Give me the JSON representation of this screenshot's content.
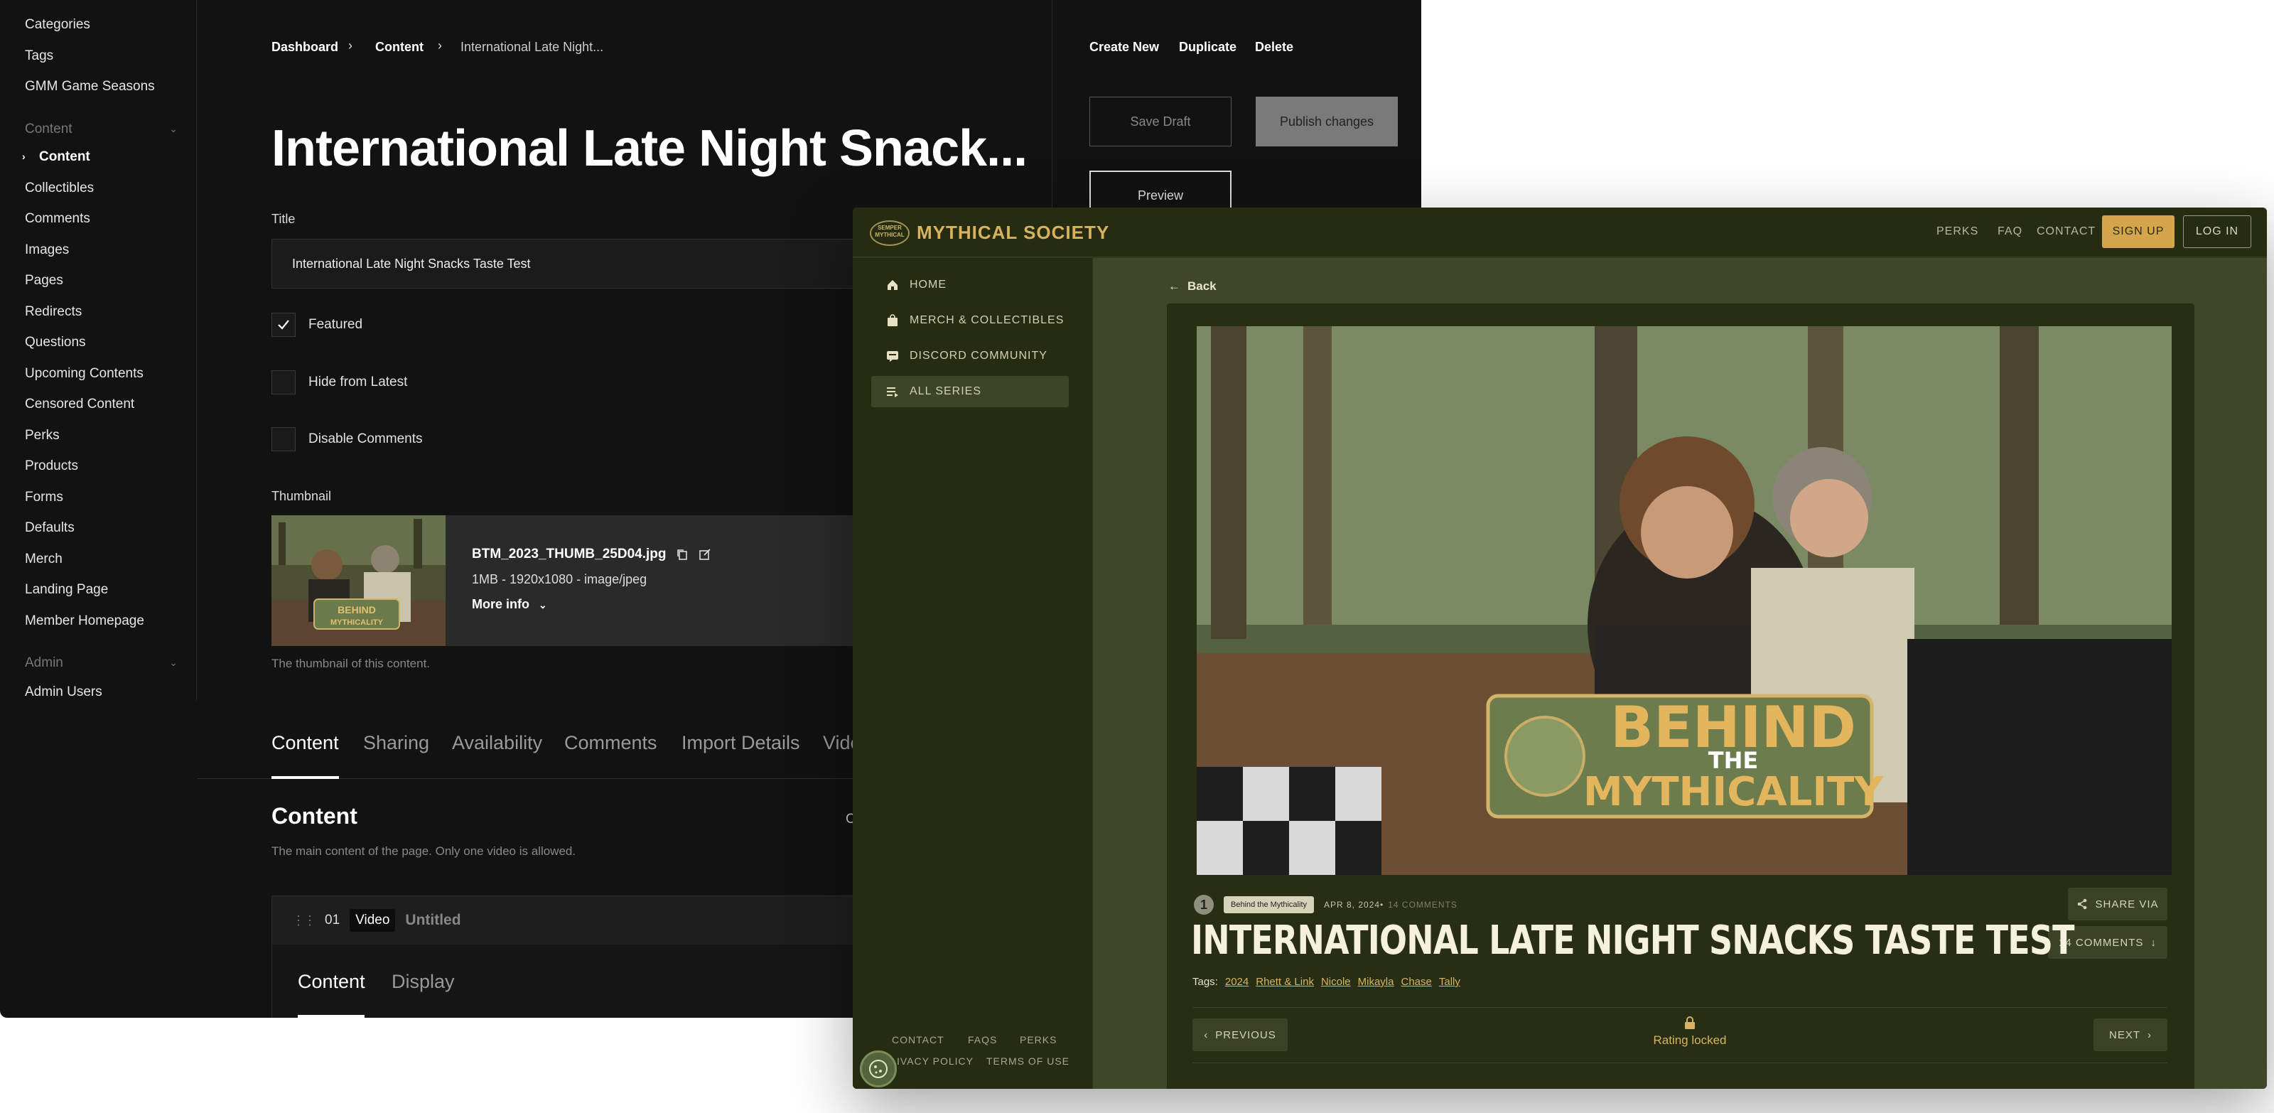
{
  "cms": {
    "sidebar": {
      "items_top": [
        "Categories",
        "Tags",
        "GMM Game Seasons"
      ],
      "content_group": "Content",
      "content_items": [
        "Content",
        "Collectibles",
        "Comments",
        "Images",
        "Pages",
        "Redirects",
        "Questions",
        "Upcoming Contents",
        "Censored Content",
        "Perks",
        "Products",
        "Forms",
        "Defaults",
        "Merch",
        "Landing Page",
        "Member Homepage"
      ],
      "admin_group": "Admin",
      "admin_items": [
        "Admin Users"
      ]
    },
    "breadcrumb": {
      "dashboard": "Dashboard",
      "content": "Content",
      "current": "International Late Night..."
    },
    "page_title": "International Late Night Snack...",
    "title_label": "Title",
    "title_value": "International Late Night Snacks Taste Test",
    "checkboxes": {
      "featured": "Featured",
      "hide_latest": "Hide from Latest",
      "disable_comments": "Disable Comments"
    },
    "thumbnail": {
      "label": "Thumbnail",
      "filename": "BTM_2023_THUMB_25D04.jpg",
      "meta": "1MB - 1920x1080 - image/jpeg",
      "more_info": "More info",
      "help": "The thumbnail of this content."
    },
    "tabs": [
      "Content",
      "Sharing",
      "Availability",
      "Comments",
      "Import Details",
      "Vide"
    ],
    "section": {
      "title": "Content",
      "help": "The main content of the page. Only one video is allowed.",
      "truncated": "C"
    },
    "block": {
      "number": "01",
      "type": "Video",
      "name": "Untitled",
      "tabs": [
        "Content",
        "Display"
      ]
    },
    "actions": {
      "create_new": "Create New",
      "duplicate": "Duplicate",
      "delete": "Delete",
      "save_draft": "Save Draft",
      "publish": "Publish changes",
      "preview": "Preview"
    }
  },
  "site": {
    "logo_badge": "SEMPER MYTHICAL",
    "logo_text": "MYTHICAL SOCIETY",
    "nav": [
      "PERKS",
      "FAQ",
      "CONTACT"
    ],
    "signup": "SIGN UP",
    "login": "LOG IN",
    "sidebar": [
      "HOME",
      "MERCH & COLLECTIBLES",
      "DISCORD COMMUNITY",
      "ALL SERIES"
    ],
    "footer": {
      "contact": "CONTACT",
      "faqs": "FAQS",
      "perks": "PERKS",
      "privacy": "IVACY POLICY",
      "terms": "TERMS OF USE"
    },
    "back": "Back",
    "video_overlay": {
      "line1": "BEHIND",
      "line2": "THE",
      "line3": "MYTHICALITY"
    },
    "season_number": "1",
    "series_chip": "Behind the Mythicality",
    "date": "APR 8, 2024•",
    "comments_count": "14 COMMENTS",
    "share": "SHARE VIA",
    "comments_btn": "14 COMMENTS",
    "article_title": "INTERNATIONAL LATE NIGHT SNACKS TASTE TEST",
    "tags_label": "Tags:",
    "tags": [
      "2024",
      "Rhett & Link",
      "Nicole",
      "Mikayla",
      "Chase",
      "Tally"
    ],
    "previous": "PREVIOUS",
    "next": "NEXT",
    "rating_locked": "Rating locked"
  },
  "colors": {
    "accent_gold": "#d4a54a",
    "site_bg": "#2d3419",
    "cms_bg": "#121212"
  }
}
